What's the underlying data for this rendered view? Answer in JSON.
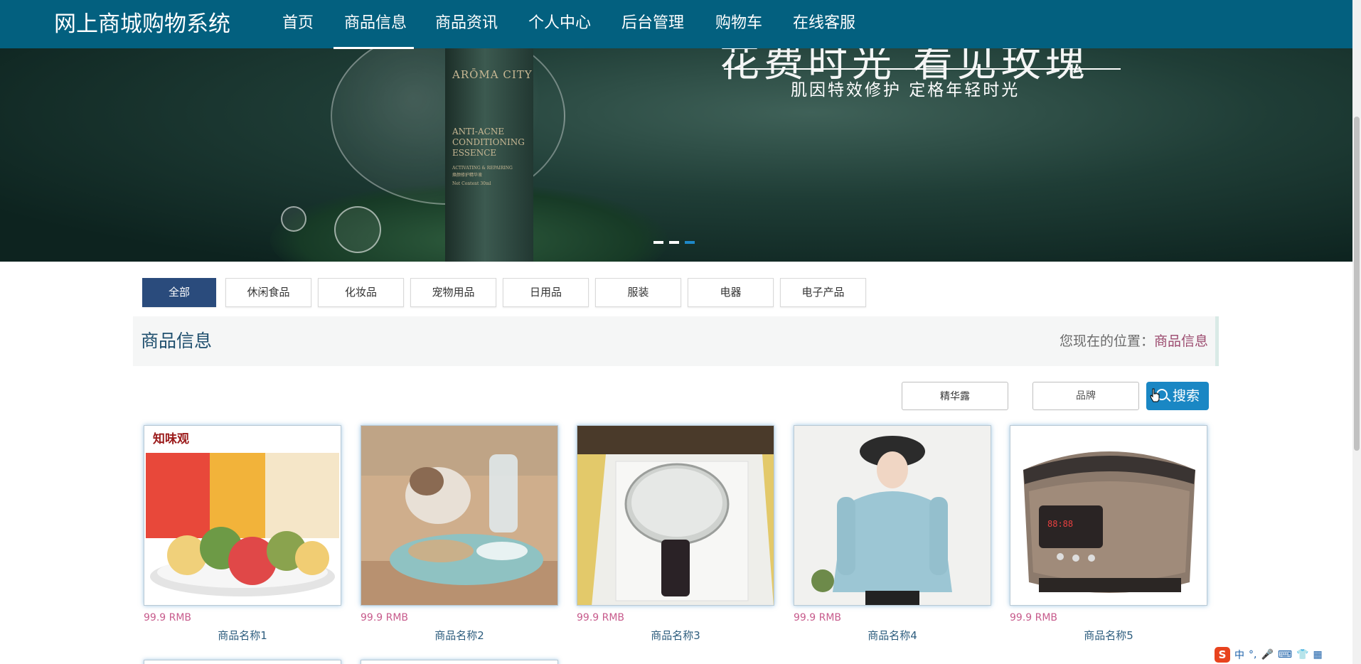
{
  "header": {
    "brand": "网上商城购物系统",
    "nav": [
      "首页",
      "商品信息",
      "商品资讯",
      "个人中心",
      "后台管理",
      "购物车",
      "在线客服"
    ],
    "active_nav": "商品信息"
  },
  "banner": {
    "headline": "花费时光 看见玫瑰",
    "subtitle": "肌因特效修护   定格年轻时光",
    "product_brand": "ARŌMA CITY",
    "product_lines": [
      "ANTI-ACNE",
      "CONDITIONING",
      "ESSENCE"
    ],
    "product_small": [
      "ACTIVATING & REPAIRING",
      "焕颜修护精华液",
      "Net Content 30ml"
    ],
    "slide_count": 3,
    "active_slide": 3
  },
  "categories": [
    "全部",
    "休闲食品",
    "化妆品",
    "宠物用品",
    "日用品",
    "服装",
    "电器",
    "电子产品"
  ],
  "active_category": "全部",
  "section": {
    "title": "商品信息",
    "location_label": "您现在的位置：",
    "location_value": "商品信息"
  },
  "search": {
    "field1_value": "精华露",
    "field2_placeholder": "品牌",
    "button_label": "搜索"
  },
  "products": [
    {
      "price": "99.9 RMB",
      "name": "商品名称1",
      "image": "mooncake-gift-box"
    },
    {
      "price": "99.9 RMB",
      "name": "商品名称2",
      "image": "cat-feeder-bowl"
    },
    {
      "price": "99.9 RMB",
      "name": "商品名称3",
      "image": "handheld-mirror"
    },
    {
      "price": "99.9 RMB",
      "name": "商品名称4",
      "image": "blue-hoodie-model"
    },
    {
      "price": "99.9 RMB",
      "name": "商品名称5",
      "image": "rice-cooker"
    }
  ],
  "ime_toolbar": {
    "logo": "S",
    "items": [
      "中",
      "°,",
      "🎤",
      "⌨",
      "👕",
      "▦"
    ]
  },
  "colors": {
    "nav_bg": "#03607f",
    "active_category_bg": "#2a4b7c",
    "search_button": "#1a87c4",
    "price": "#c75b8c",
    "product_name": "#2d5d7e"
  }
}
